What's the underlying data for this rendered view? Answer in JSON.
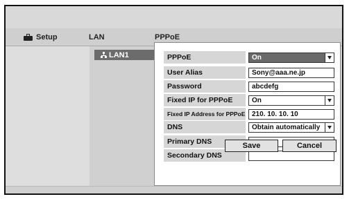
{
  "header": {
    "setup_label": "Setup",
    "lan_label": "LAN",
    "pppoe_label": "PPPoE"
  },
  "sidebar": {
    "selected_item": "LAN1"
  },
  "form": {
    "fields": [
      {
        "label": "PPPoE",
        "value": "On",
        "type": "dropdown"
      },
      {
        "label": "User Alias",
        "value": "Sony@aaa.ne.jp",
        "type": "text"
      },
      {
        "label": "Password",
        "value": "abcdefg",
        "type": "text"
      },
      {
        "label": "Fixed IP for PPPoE",
        "value": "On",
        "type": "dropdown"
      },
      {
        "label": "Fixed IP Address for PPPoE",
        "value": "210. 10. 10. 10",
        "type": "text"
      },
      {
        "label": "DNS",
        "value": "Obtain automatically",
        "type": "dropdown"
      },
      {
        "label": "Primary DNS",
        "value": "",
        "type": "text"
      },
      {
        "label": "Secondary DNS",
        "value": "",
        "type": "text"
      }
    ],
    "save_label": "Save",
    "cancel_label": "Cancel"
  },
  "icons": {
    "setup": "toolbox-icon",
    "lan1": "network-icon",
    "dropdown": "chevron-down-icon"
  }
}
